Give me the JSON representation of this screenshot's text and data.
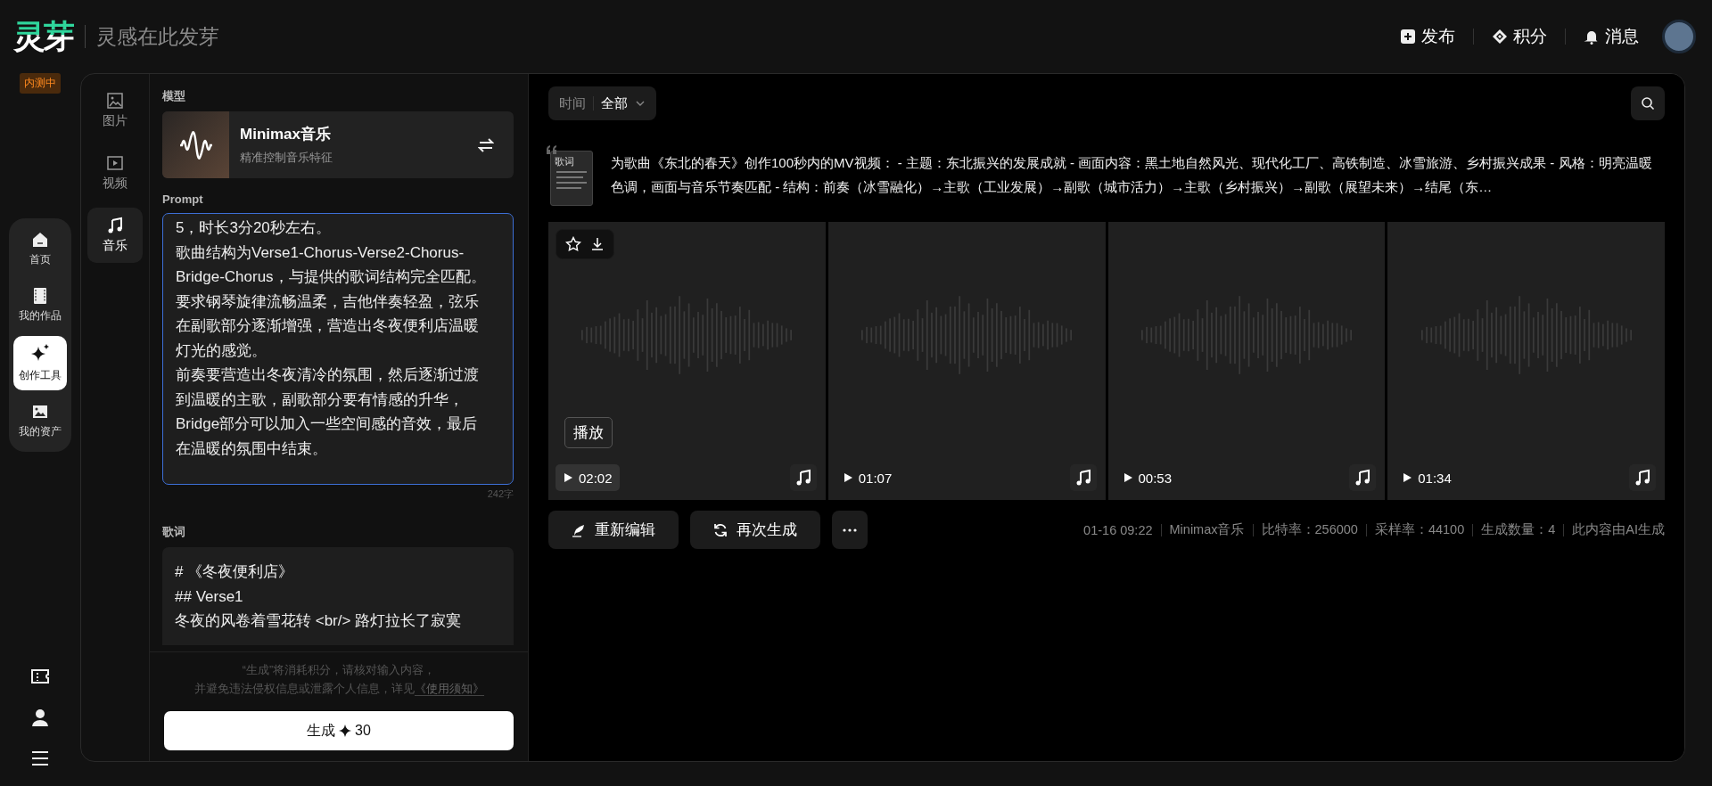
{
  "header": {
    "logo": "灵芽",
    "slogan": "灵感在此发芽",
    "actions": [
      {
        "kind": "publish",
        "label": "发布"
      },
      {
        "kind": "points",
        "label": "积分"
      },
      {
        "kind": "messages",
        "label": "消息"
      }
    ]
  },
  "beta_badge": "内测中",
  "left_nav": [
    {
      "kind": "home",
      "label": "首页",
      "selected": false
    },
    {
      "kind": "works",
      "label": "我的作品",
      "selected": false
    },
    {
      "kind": "tools",
      "label": "创作工具",
      "selected": true
    },
    {
      "kind": "assets",
      "label": "我的资产",
      "selected": false
    }
  ],
  "tools": [
    {
      "kind": "image",
      "label": "图片",
      "selected": false
    },
    {
      "kind": "video",
      "label": "视频",
      "selected": false
    },
    {
      "kind": "music",
      "label": "音乐",
      "selected": true
    }
  ],
  "form": {
    "model_label": "模型",
    "model": {
      "name": "Minimax音乐",
      "description": "精准控制音乐特征"
    },
    "prompt_label": "Prompt",
    "prompt_lines": [
      "5，时长3分20秒左右。",
      "歌曲结构为Verse1-Chorus-Verse2-Chorus-Bridge-Chorus，与提供的歌词结构完全匹配。",
      "要求钢琴旋律流畅温柔，吉他伴奏轻盈，弦乐在副歌部分逐渐增强，营造出冬夜便利店温暖灯光的感觉。",
      "前奏要营造出冬夜清冷的氛围，然后逐渐过渡到温暖的主歌，副歌部分要有情感的升华，Bridge部分可以加入一些空间感的音效，最后在温暖的氛围中结束。"
    ],
    "char_count": "242字",
    "lyrics_label": "歌词",
    "lyrics_lines": [
      "# 《冬夜便利店》",
      "## Verse1",
      "冬夜的风卷着雪花转 <br/> 路灯拉长了寂寞"
    ],
    "notice_lines": [
      "“生成”将消耗积分，请核对输入内容，",
      "并避免违法侵权信息或泄露个人信息，详见"
    ],
    "notice_link": "《使用须知》",
    "generate": {
      "label": "生成",
      "cost": "30"
    }
  },
  "results": {
    "filter": {
      "label": "时间",
      "value": "全部"
    },
    "thumbnail_label": "歌词",
    "description": "为歌曲《东北的春天》创作100秒内的MV视频： - 主题：东北振兴的发展成就 - 画面内容：黑土地自然风光、现代化工厂、高铁制造、冰雪旅游、乡村振兴成果 - 风格：明亮温暖色调，画面与音乐节奏匹配 - 结构：前奏（冰雪融化）→主歌（工业发展）→副歌（城市活力）→主歌（乡村振兴）→副歌（展望未来）→结尾（东…",
    "cards": [
      {
        "duration": "02:02",
        "hovered": true,
        "tooltip": "播放"
      },
      {
        "duration": "01:07",
        "hovered": false
      },
      {
        "duration": "00:53",
        "hovered": false
      },
      {
        "duration": "01:34",
        "hovered": false
      }
    ],
    "actions": [
      {
        "kind": "edit",
        "label": "重新编辑"
      },
      {
        "kind": "regenerate",
        "label": "再次生成"
      },
      {
        "kind": "more"
      }
    ],
    "meta": [
      "01-16 09:22",
      "Minimax音乐",
      "比特率：256000",
      "采样率：44100",
      "生成数量：4",
      "此内容由AI生成"
    ]
  }
}
